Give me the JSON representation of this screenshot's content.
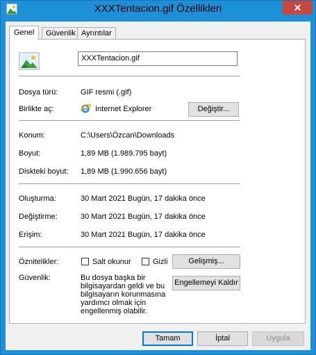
{
  "window": {
    "title": "XXXTentacion.gif Özellikleri",
    "close_glyph": "✕"
  },
  "tabs": [
    {
      "label": "Genel",
      "active": true
    },
    {
      "label": "Güvenlik",
      "active": false
    },
    {
      "label": "Ayrıntılar",
      "active": false
    }
  ],
  "general": {
    "file_name": "XXXTentacion.gif",
    "file_type_label": "Dosya türü:",
    "file_type_value": "GIF resmi (.gif)",
    "opens_with_label": "Birlikte aç:",
    "opens_with_value": "Internet Explorer",
    "change_button": "Değiştir...",
    "location_label": "Konum:",
    "location_value": "C:\\Users\\Özcan\\Downloads",
    "size_label": "Boyut:",
    "size_value": "1,89 MB (1.989.795 bayt)",
    "size_on_disk_label": "Diskteki boyut:",
    "size_on_disk_value": "1,89 MB (1.990.656 bayt)",
    "created_label": "Oluşturma:",
    "created_value": "30 Mart 2021 Bugün, 17 dakika önce",
    "modified_label": "Değiştirme:",
    "modified_value": "30 Mart 2021 Bugün, 17 dakika önce",
    "accessed_label": "Erişim:",
    "accessed_value": "30 Mart 2021 Bugün, 17 dakika önce",
    "attributes_label": "Öznitelikler:",
    "readonly_label": "Salt okunur",
    "readonly_checked": false,
    "hidden_label": "Gizli",
    "hidden_checked": false,
    "advanced_button": "Gelişmiş...",
    "security_label": "Güvenlik:",
    "security_text": "Bu dosya başka bir bilgisayardan geldi ve bu bilgisayarın korunmasına yardımcı olmak için engellenmiş olabilir.",
    "unblock_button": "Engellemeyi Kaldır"
  },
  "footer": {
    "ok_button": "Tamam",
    "cancel_button": "İptal",
    "apply_button": "Uygula"
  },
  "icons": {
    "title_icon": "image-file-icon",
    "file_icon": "image-file-icon",
    "browser_icon": "internet-explorer-icon"
  }
}
